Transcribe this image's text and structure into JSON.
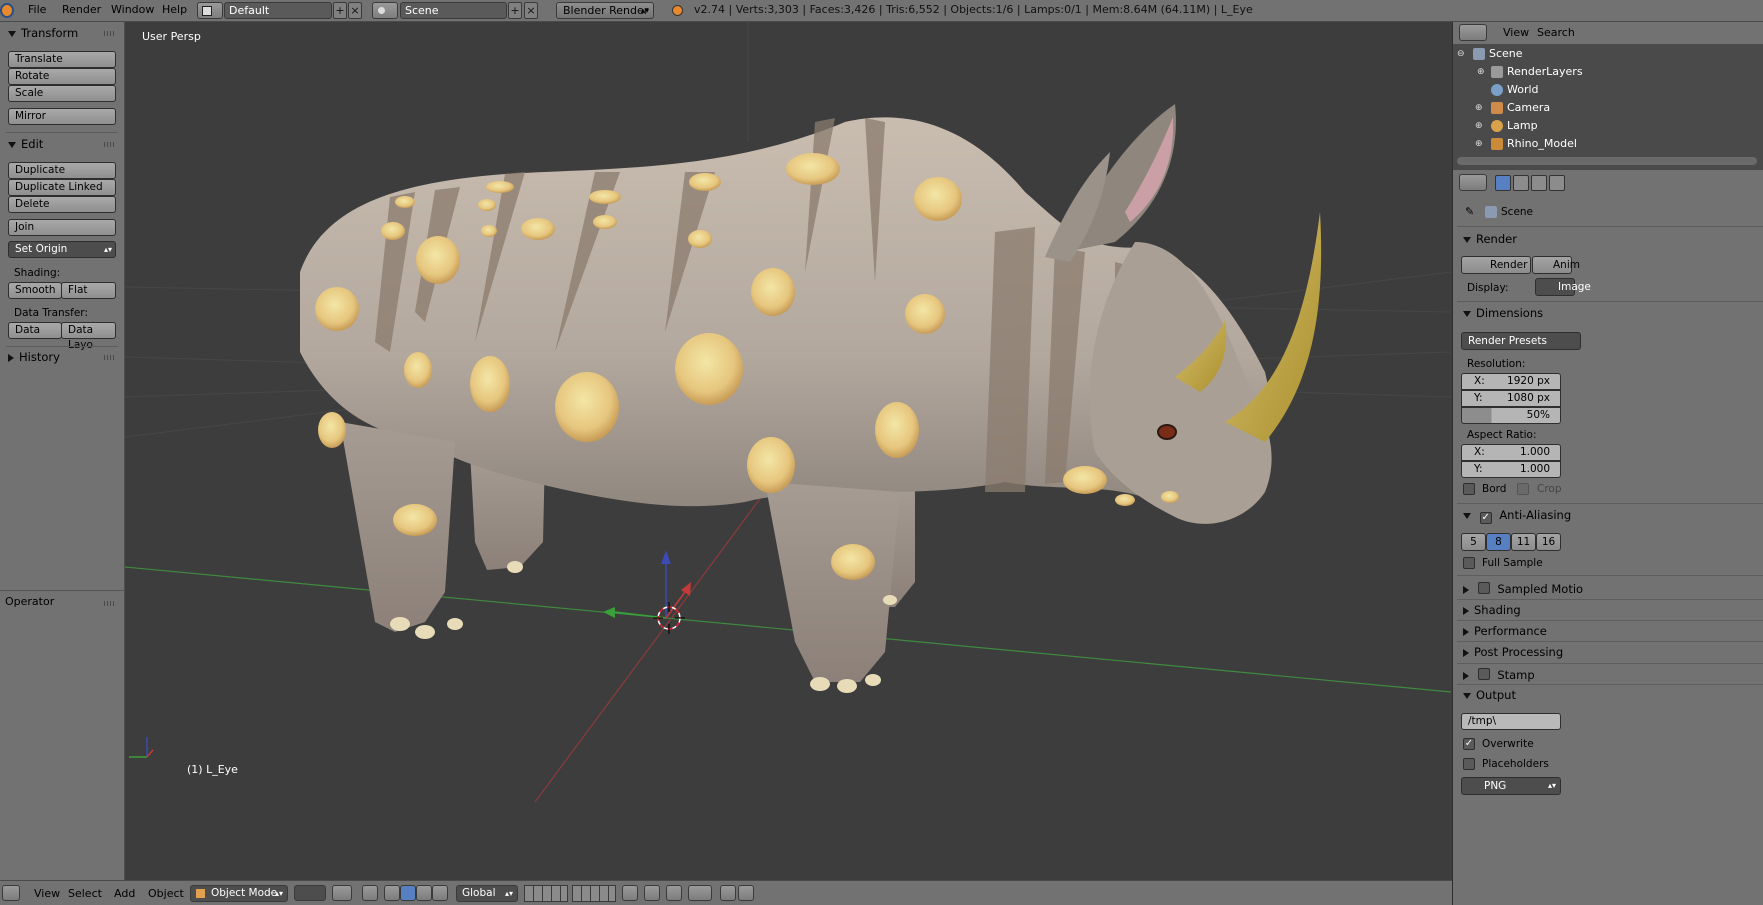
{
  "topbar": {
    "menus": [
      "File",
      "Render",
      "Window",
      "Help"
    ],
    "screen_layout": "Default",
    "scene": "Scene",
    "render_engine": "Blender Render",
    "stats": "v2.74 | Verts:3,303 | Faces:3,426 | Tris:6,552 | Objects:1/6 | Lamps:0/1 | Mem:8.64M (64.11M) | L_Eye"
  },
  "toolshelf": {
    "transform_title": "Transform",
    "translate": "Translate",
    "rotate": "Rotate",
    "scale": "Scale",
    "mirror": "Mirror",
    "edit_title": "Edit",
    "duplicate": "Duplicate",
    "duplicate_linked": "Duplicate Linked",
    "delete": "Delete",
    "join": "Join",
    "set_origin": "Set Origin",
    "shading_label": "Shading:",
    "smooth": "Smooth",
    "flat": "Flat",
    "data_transfer_label": "Data Transfer:",
    "data": "Data",
    "data_layout": "Data Layo",
    "history_title": "History",
    "operator_title": "Operator"
  },
  "viewport": {
    "view_name": "User Persp",
    "active_object": "(1) L_Eye"
  },
  "outliner": {
    "view_menu": "View",
    "search_menu": "Search",
    "items": [
      "Scene",
      "RenderLayers",
      "World",
      "Camera",
      "Lamp",
      "Rhino_Model"
    ]
  },
  "properties": {
    "context": "Scene",
    "render_title": "Render",
    "render_btn": "Render",
    "anim_btn": "Anim",
    "display_label": "Display:",
    "display_value": "Image",
    "dimensions_title": "Dimensions",
    "render_presets": "Render Presets",
    "resolution_label": "Resolution:",
    "res_x": "1920 px",
    "res_y": "1080 px",
    "res_percent": "50%",
    "aspect_label": "Aspect Ratio:",
    "aspect_x": "1.000",
    "aspect_y": "1.000",
    "x_label": "X:",
    "y_label": "Y:",
    "bord": "Bord",
    "crop": "Crop",
    "antialiasing_title": "Anti-Aliasing",
    "aa_samples": [
      "5",
      "8",
      "11",
      "16"
    ],
    "aa_selected": "8",
    "full_sample": "Full Sample",
    "sampled_motion": "Sampled Motio",
    "shading_title": "Shading",
    "performance_title": "Performance",
    "post_processing_title": "Post Processing",
    "stamp_title": "Stamp",
    "output_title": "Output",
    "output_path": "/tmp\\",
    "overwrite": "Overwrite",
    "placeholders": "Placeholders",
    "file_format": "PNG"
  },
  "bottombar": {
    "menus": [
      "View",
      "Select",
      "Add",
      "Object"
    ],
    "mode": "Object Mode",
    "orientation": "Global"
  },
  "colors": {
    "ui_gray": "#727272",
    "viewport_bg": "#3d3d3d",
    "selected_blue": "#5680c2"
  }
}
